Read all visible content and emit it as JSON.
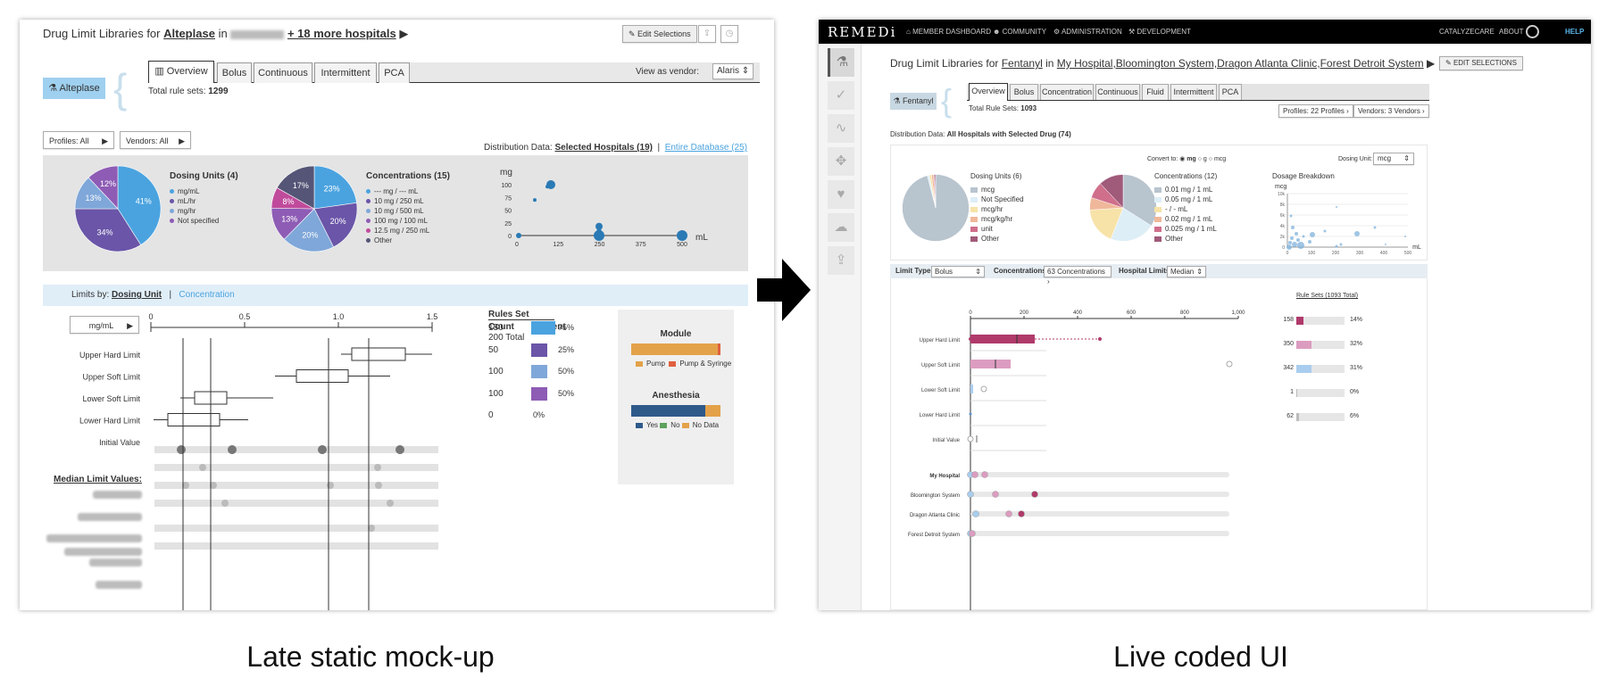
{
  "captions": {
    "left": "Late static mock-up",
    "right": "Live coded UI"
  },
  "left": {
    "title_prefix": "Drug Limit Libraries for",
    "drug": "Alteplase",
    "in": "in",
    "hospitals": "+ 18 more hospitals",
    "edit_selections": "Edit Selections",
    "drug_badge": "Alteplase",
    "tabs": [
      "Overview",
      "Bolus",
      "Continuous",
      "Intermittent",
      "PCA"
    ],
    "view_as_vendor_label": "View as vendor:",
    "vendor_value": "Alaris",
    "total_rule_sets_label": "Total rule sets:",
    "total_rule_sets": "1299",
    "profiles_btn": "Profiles: All",
    "vendors_btn": "Vendors: All",
    "distribution_label": "Distribution Data:",
    "distribution_selected": "Selected Hospitals (19)",
    "distribution_sep": "|",
    "distribution_entire": "Entire Database (25)",
    "dosing_units": {
      "title": "Dosing Units (4)",
      "legend": [
        "mg/mL",
        "mL/hr",
        "mg/hr",
        "Not specified"
      ],
      "slices": [
        41,
        34,
        13,
        12
      ],
      "labels": [
        "41%",
        "34%",
        "13%",
        "12%"
      ],
      "colors": [
        "#4aa3df",
        "#6a55a8",
        "#7fa7d9",
        "#8e5cb5"
      ]
    },
    "concentrations": {
      "title": "Concentrations (15)",
      "legend": [
        "--- mg / --- mL",
        "10 mg / 250 mL",
        "10 mg / 500 mL",
        "100 mg / 100 mL",
        "12.5 mg / 250 mL",
        "Other"
      ],
      "slices": [
        23,
        20,
        20,
        13,
        8,
        17
      ],
      "labels": [
        "23%",
        "20%",
        "20%",
        "13%",
        "8%",
        "17%"
      ],
      "colors": [
        "#4aa3df",
        "#6a55a8",
        "#7fa7d9",
        "#8e5cb5",
        "#c04b9c",
        "#555577"
      ]
    },
    "scatter": {
      "ylabel": "mg",
      "xlabel": "mL",
      "yticks": [
        "100",
        "75",
        "50",
        "25",
        "0"
      ],
      "xticks": [
        "0",
        "125",
        "250",
        "375",
        "500"
      ]
    },
    "limits_by_label": "Limits by:",
    "limits_by_dosing": "Dosing Unit",
    "limits_by_sep": "|",
    "limits_by_conc": "Concentration",
    "unit_btn": "mg/mL",
    "axis_ticks": [
      "0",
      "0.5",
      "1.0",
      "1.5"
    ],
    "rules_set_title": "Rules Set",
    "count_label": "Count",
    "percent_label": "Percent",
    "total_label": "200 Total",
    "rows": [
      {
        "label": "Upper Hard Limit",
        "count": "150",
        "pct": "75%",
        "frac": 0.75,
        "color": "#4aa3df"
      },
      {
        "label": "Upper Soft Limit",
        "count": "50",
        "pct": "25%",
        "frac": 0.25,
        "color": "#6a55a8"
      },
      {
        "label": "Lower Soft Limit",
        "count": "100",
        "pct": "50%",
        "frac": 0.5,
        "color": "#7fa7d9"
      },
      {
        "label": "Lower Hard Limit",
        "count": "100",
        "pct": "50%",
        "frac": 0.5,
        "color": "#8e5cb5"
      },
      {
        "label": "Initial Value",
        "count": "0",
        "pct": "0%",
        "frac": 0,
        "color": "#ccc"
      }
    ],
    "median_title": "Median Limit Values:",
    "module": {
      "title": "Module",
      "legend": [
        "Pump",
        "Pump & Syringe"
      ]
    },
    "anesthesia": {
      "title": "Anesthesia",
      "legend": [
        "Yes",
        "No",
        "No Data"
      ]
    }
  },
  "right": {
    "brand": "REMEDi",
    "nav": [
      "MEMBER DASHBOARD",
      "COMMUNITY",
      "ADMINISTRATION",
      "DEVELOPMENT"
    ],
    "nav_right": [
      "CATALYZECARE",
      "ABOUT"
    ],
    "help": "HELP",
    "title_prefix": "Drug Limit Libraries for",
    "drug": "Fentanyl",
    "in": "in",
    "hospitals": [
      "My Hospital",
      "Bloomington System",
      "Dragon Atlanta Clinic",
      "Forest Detroit System"
    ],
    "edit_selections": "EDIT SELECTIONS",
    "drug_badge": "Fentanyl",
    "tabs": [
      "Overview",
      "Bolus",
      "Concentration",
      "Continuous",
      "Fluid",
      "Intermittent",
      "PCA"
    ],
    "total_rule_sets_label": "Total Rule Sets:",
    "total_rule_sets": "1093",
    "profiles_btn": "Profiles: 22 Profiles",
    "vendors_btn": "Vendors: 3 Vendors",
    "distribution_label": "Distribution Data:",
    "distribution_value": "All Hospitals with Selected Drug (74)",
    "convert_to_label": "Convert to:",
    "convert_options": [
      "mg",
      "g",
      "mcg"
    ],
    "dosing_unit_label": "Dosing Unit:",
    "dosing_unit_value": "mcg",
    "dosing_units": {
      "title": "Dosing Units (6)",
      "legend": [
        "mcg",
        "Not Specified",
        "mcg/hr",
        "mcg/kg/hr",
        "unit",
        "Other"
      ],
      "colors": [
        "#b8c4ce",
        "#ddeef7",
        "#f7e3a8",
        "#f0b89a",
        "#cf6f8c",
        "#a05a7a"
      ]
    },
    "concentrations": {
      "title": "Concentrations (12)",
      "legend": [
        "0.01 mg / 1 mL",
        "0.05 mg / 1 mL",
        "- / - mL",
        "0.02 mg / 1 mL",
        "0.025 mg / 1 mL",
        "Other"
      ],
      "colors": [
        "#b8c4ce",
        "#ddeef7",
        "#f7e3a8",
        "#f0b89a",
        "#cf6f8c",
        "#a05a7a"
      ]
    },
    "dosage": {
      "title": "Dosage Breakdown",
      "ylabel": "mcg",
      "xlabel": "mL",
      "yticks": [
        "10k",
        "8k",
        "6k",
        "4k",
        "2k",
        "0"
      ],
      "xticks": [
        "0",
        "100",
        "200",
        "300",
        "400",
        "500"
      ]
    },
    "limit_type_label": "Limit Type:",
    "limit_type_value": "Bolus",
    "concentrations_label": "Concentrations:",
    "concentrations_value": "63 Concentrations",
    "hospital_limits_label": "Hospital Limits:",
    "hospital_limits_value": "Median",
    "axis_ticks": [
      "0",
      "200",
      "400",
      "600",
      "800",
      "1,000"
    ],
    "rule_sets_title": "Rule Sets (1093 Total)",
    "rows": [
      {
        "label": "Upper Hard Limit",
        "count": "158",
        "pct": "14%",
        "frac": 0.14,
        "color": "#b03a6a"
      },
      {
        "label": "Upper Soft Limit",
        "count": "350",
        "pct": "32%",
        "frac": 0.32,
        "color": "#dc9cc0"
      },
      {
        "label": "Lower Soft Limit",
        "count": "342",
        "pct": "31%",
        "frac": 0.31,
        "color": "#a9cdee"
      },
      {
        "label": "Lower Hard Limit",
        "count": "1",
        "pct": "0%",
        "frac": 0.005,
        "color": "#bbb"
      },
      {
        "label": "Initial Value",
        "count": "62",
        "pct": "6%",
        "frac": 0.06,
        "color": "#bbb"
      }
    ]
  }
}
